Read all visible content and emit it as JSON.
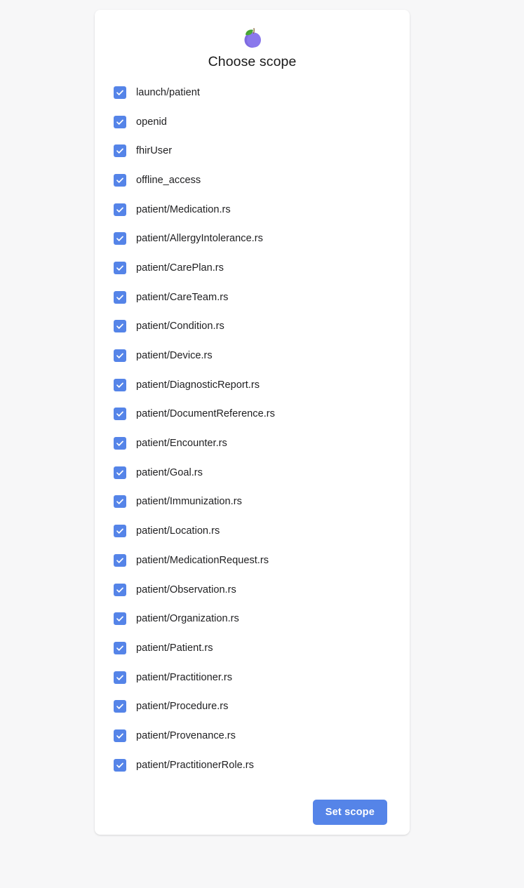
{
  "page": {
    "background_color": "#f7f7f8",
    "card_background": "#ffffff"
  },
  "card": {
    "logo_icon": "plum-fruit-icon",
    "title": "Choose scope",
    "accent_color": "#5584e8",
    "text_color": "#1f1f21"
  },
  "scopes": [
    {
      "label": "launch/patient",
      "checked": true
    },
    {
      "label": "openid",
      "checked": true
    },
    {
      "label": "fhirUser",
      "checked": true
    },
    {
      "label": "offline_access",
      "checked": true
    },
    {
      "label": "patient/Medication.rs",
      "checked": true
    },
    {
      "label": "patient/AllergyIntolerance.rs",
      "checked": true
    },
    {
      "label": "patient/CarePlan.rs",
      "checked": true
    },
    {
      "label": "patient/CareTeam.rs",
      "checked": true
    },
    {
      "label": "patient/Condition.rs",
      "checked": true
    },
    {
      "label": "patient/Device.rs",
      "checked": true
    },
    {
      "label": "patient/DiagnosticReport.rs",
      "checked": true
    },
    {
      "label": "patient/DocumentReference.rs",
      "checked": true
    },
    {
      "label": "patient/Encounter.rs",
      "checked": true
    },
    {
      "label": "patient/Goal.rs",
      "checked": true
    },
    {
      "label": "patient/Immunization.rs",
      "checked": true
    },
    {
      "label": "patient/Location.rs",
      "checked": true
    },
    {
      "label": "patient/MedicationRequest.rs",
      "checked": true
    },
    {
      "label": "patient/Observation.rs",
      "checked": true
    },
    {
      "label": "patient/Organization.rs",
      "checked": true
    },
    {
      "label": "patient/Patient.rs",
      "checked": true
    },
    {
      "label": "patient/Practitioner.rs",
      "checked": true
    },
    {
      "label": "patient/Procedure.rs",
      "checked": true
    },
    {
      "label": "patient/Provenance.rs",
      "checked": true
    },
    {
      "label": "patient/PractitionerRole.rs",
      "checked": true
    }
  ],
  "footer": {
    "submit_label": "Set scope"
  }
}
